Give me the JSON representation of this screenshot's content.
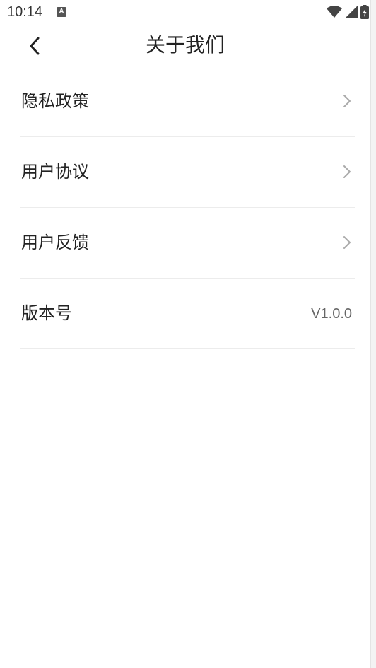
{
  "status_bar": {
    "time": "10:14",
    "notify_icon_label": "A"
  },
  "header": {
    "title": "关于我们"
  },
  "menu": {
    "items": [
      {
        "label": "隐私政策"
      },
      {
        "label": "用户协议"
      },
      {
        "label": "用户反馈"
      },
      {
        "label": "版本号",
        "value": "V1.0.0"
      }
    ]
  },
  "colors": {
    "text": "#222222",
    "secondary_text": "#666666",
    "chevron": "#aaaaaa",
    "divider": "#ececec",
    "background": "#ffffff"
  }
}
